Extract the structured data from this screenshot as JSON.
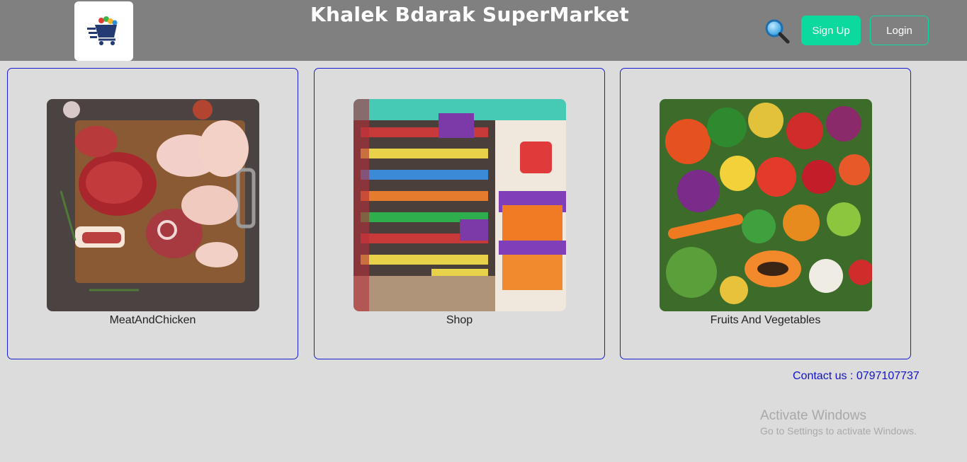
{
  "header": {
    "title": "Khalek Bdarak SuperMarket",
    "logo_icon": "grocery-cart-logo",
    "search_icon": "search-icon",
    "signup_label": "Sign Up",
    "login_label": "Login",
    "colors": {
      "bar": "#808080",
      "accent": "#0bd99e"
    }
  },
  "categories": [
    {
      "label": "MeatAndChicken",
      "image": "meat-and-chicken-photo"
    },
    {
      "label": "Shop",
      "image": "store-shelves-photo"
    },
    {
      "label": "Fruits And Vegetables",
      "image": "fruits-and-vegetables-photo"
    }
  ],
  "footer": {
    "contact": "Contact us : 0797107737"
  },
  "watermark": {
    "title": "Activate Windows",
    "subtitle": "Go to Settings to activate Windows."
  }
}
